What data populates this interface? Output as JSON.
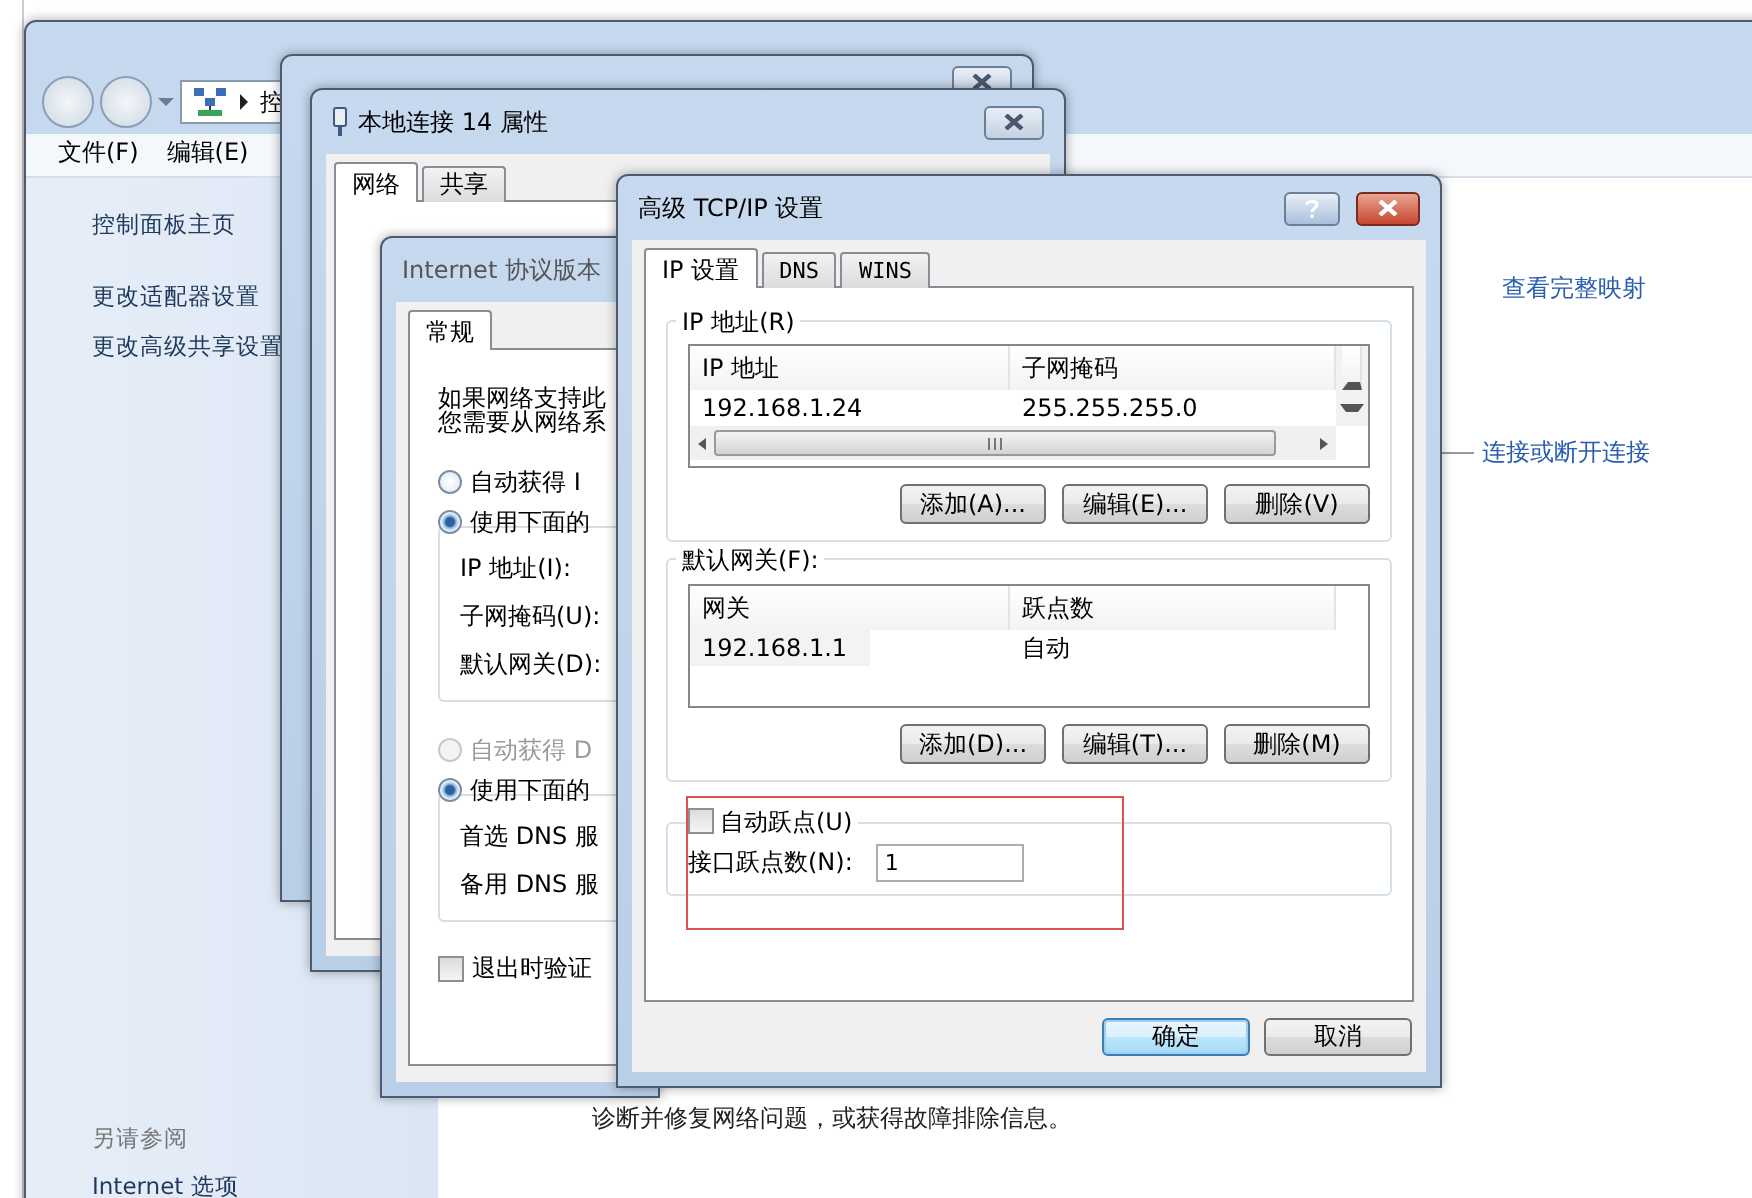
{
  "explorer": {
    "address_crumb": "控",
    "menu": [
      "文件(F)",
      "编辑(E)"
    ],
    "sidebar_links": [
      "控制面板主页",
      "更改适配器设置",
      "更改高级共享设置"
    ],
    "see_also_title": "另请参阅",
    "see_also_links": [
      "Internet 选项"
    ],
    "content_links": [
      "查看完整映射",
      "连接或断开连接"
    ],
    "footer_text": "诊断并修复网络问题，或获得故障排除信息。"
  },
  "properties_window": {
    "title": "本地连接 14 属性",
    "tabs": [
      {
        "label": "网络",
        "selected": true
      },
      {
        "label": "共享",
        "selected": false
      }
    ]
  },
  "ipv4_window": {
    "title": "Internet 协议版本",
    "tabs": [
      {
        "label": "常规",
        "selected": true
      }
    ],
    "intro": [
      "如果网络支持此",
      "您需要从网络系"
    ],
    "sections": [
      {
        "radios": [
          {
            "label": "自动获得 I",
            "selected": false,
            "disabled": false
          },
          {
            "label": "使用下面的",
            "selected": true,
            "disabled": false
          }
        ],
        "fields": [
          "IP 地址(I):",
          "子网掩码(U):",
          "默认网关(D):"
        ]
      },
      {
        "radios": [
          {
            "label": "自动获得 D",
            "selected": false,
            "disabled": true
          },
          {
            "label": "使用下面的",
            "selected": true,
            "disabled": false
          }
        ],
        "fields": [
          "首选 DNS 服",
          "备用 DNS 服"
        ]
      }
    ],
    "validate_checkbox": {
      "label": "退出时验证",
      "checked": false
    }
  },
  "advanced_window": {
    "title": "高级 TCP/IP 设置",
    "tabs": [
      {
        "label": "IP 设置",
        "selected": true
      },
      {
        "label": "DNS",
        "selected": false
      },
      {
        "label": "WINS",
        "selected": false
      }
    ],
    "ip_group": {
      "title": "IP 地址(R)",
      "columns": [
        "IP 地址",
        "子网掩码"
      ],
      "rows": [
        [
          "192.168.1.24",
          "255.255.255.0"
        ]
      ],
      "buttons": [
        "添加(A)...",
        "编辑(E)...",
        "删除(V)"
      ]
    },
    "gateway_group": {
      "title": "默认网关(F):",
      "columns": [
        "网关",
        "跃点数"
      ],
      "rows": [
        [
          "192.168.1.1",
          "自动"
        ]
      ],
      "buttons": [
        "添加(D)...",
        "编辑(T)...",
        "删除(M)"
      ]
    },
    "metric": {
      "highlighted": true,
      "auto_label": "自动跃点(U)",
      "auto_checked": false,
      "label": "接口跃点数(N):",
      "value": "1"
    },
    "buttons": [
      {
        "label": "确定",
        "default": true
      },
      {
        "label": "取消",
        "default": false
      }
    ]
  }
}
